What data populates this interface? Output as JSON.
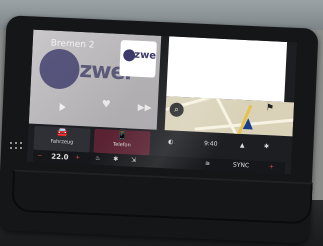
{
  "radio": {
    "station_name": "Bremen 2",
    "logo_text": "zwei",
    "badge_text": "zwei"
  },
  "shortcuts": [
    {
      "label": "Fahrzeug",
      "icon": "car-icon"
    },
    {
      "label": "Telefon",
      "icon": "phone-icon"
    }
  ],
  "quickbar": {
    "time": "9:40"
  },
  "climate": {
    "left_temp": "22.0",
    "right_label": "SYNC"
  },
  "colors": {
    "telefon_tile": "#5a2232",
    "adjust_controls": "#e04a4a",
    "nav_arrow": "#1b3e8a",
    "route": "#e8c14a"
  }
}
